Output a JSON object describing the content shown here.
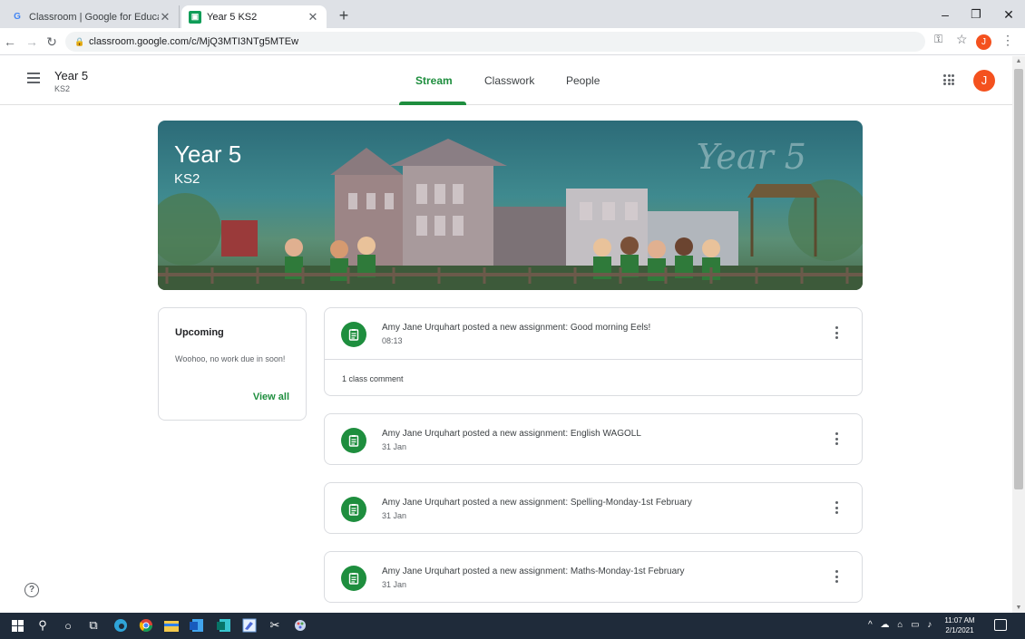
{
  "browser": {
    "tabs": [
      {
        "title": "Classroom | Google for Educatio",
        "favicon": "G"
      },
      {
        "title": "Year 5 KS2",
        "favicon": "classroom-icon"
      }
    ],
    "url": "classroom.google.com/c/MjQ3MTI3NTg5MTEw",
    "profile_initial": "J"
  },
  "classroom": {
    "class_name": "Year 5",
    "section": "KS2",
    "tabs": [
      "Stream",
      "Classwork",
      "People"
    ],
    "active_tab": "Stream",
    "avatar_initial": "J",
    "accent_color": "#1e8e3e"
  },
  "banner": {
    "title": "Year 5",
    "subtitle": "KS2",
    "decoration_text": "Year 5"
  },
  "upcoming": {
    "title": "Upcoming",
    "text": "Woohoo, no work due in soon!",
    "view_all": "View all"
  },
  "posts": [
    {
      "title": "Amy Jane Urquhart posted a new assignment: Good morning Eels!",
      "date": "08:13",
      "comment": "1 class comment"
    },
    {
      "title": "Amy Jane Urquhart posted a new assignment: English WAGOLL",
      "date": "31 Jan"
    },
    {
      "title": "Amy Jane Urquhart posted a new assignment: Spelling-Monday-1st February",
      "date": "31 Jan"
    },
    {
      "title": "Amy Jane Urquhart posted a new assignment: Maths-Monday-1st February",
      "date": "31 Jan"
    }
  ],
  "taskbar": {
    "time": "11:07 AM",
    "date": "2/1/2021"
  }
}
